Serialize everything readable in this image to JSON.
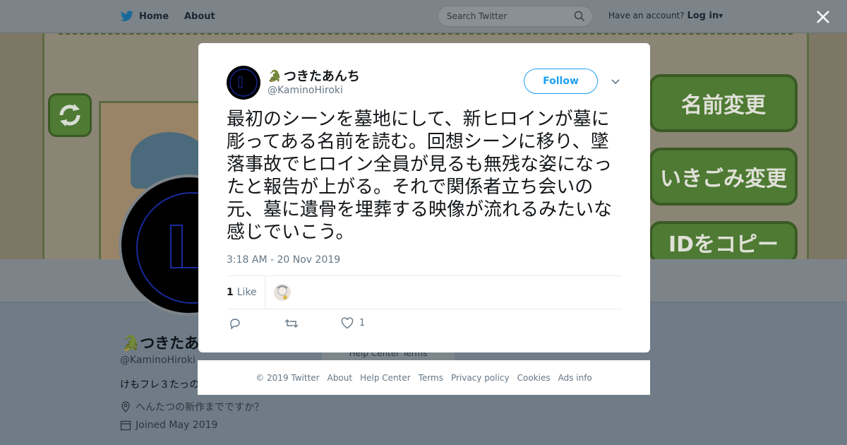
{
  "topbar": {
    "home_label": "Home",
    "about_label": "About",
    "search_placeholder": "Search Twitter",
    "have_account": "Have an account?",
    "login_label": "Log in"
  },
  "banner": {
    "buttons": [
      "名前変更",
      "いきごみ変更",
      "IDをコピー"
    ]
  },
  "profile": {
    "name": "つきたあんち",
    "handle": "@KaminoHiroki",
    "bio": "けもフレ３たっの",
    "location": "へんたつの新作までですか？",
    "joined": "Joined May 2019",
    "help_links": "Help Center   Terms"
  },
  "tweet": {
    "display_name": "つきたあんち",
    "handle": "@KaminoHiroki",
    "follow_label": "Follow",
    "text": "最初のシーンを墓地にして、新ヒロインが墓に彫ってある名前を読む。回想シーンに移り、墜落事故でヒロイン全員が見るも無残な姿になったと報告が上がる。それで関係者立ち会いの元、墓に遺骨を埋葬する映像が流れるみたいな感じでいこう。",
    "timestamp": "3:18 AM - 20 Nov 2019",
    "likes_count": "1",
    "likes_label": "Like",
    "action_like_count": "1",
    "icons": [
      "reply-icon",
      "retweet-icon",
      "heart-icon",
      "chevron-down-icon"
    ]
  },
  "footer": {
    "links": [
      "© 2019 Twitter",
      "About",
      "Help Center",
      "Terms",
      "Privacy policy",
      "Cookies",
      "Ads info"
    ]
  },
  "colors": {
    "accent": "#1da1f2",
    "overlay": "#6f7c87",
    "text_secondary": "#657786"
  }
}
